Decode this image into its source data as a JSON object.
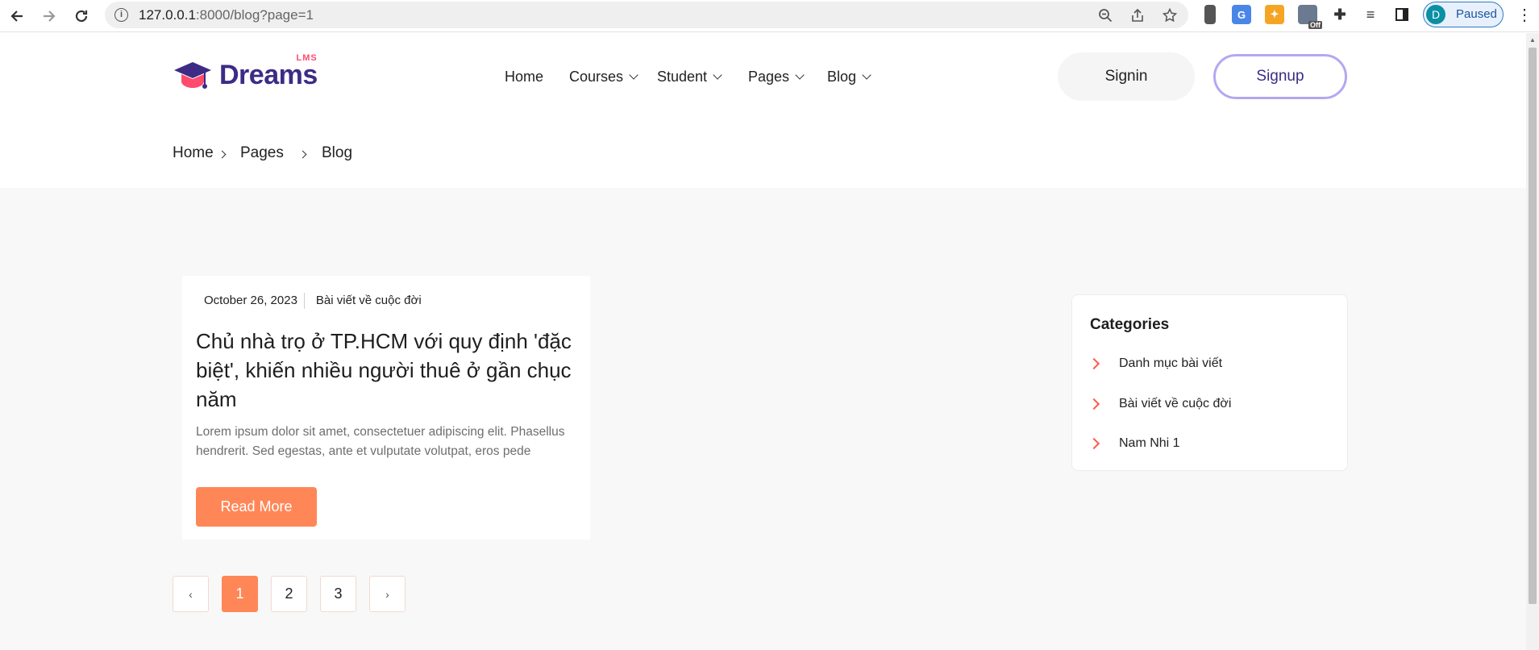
{
  "browser": {
    "url_host": "127.0.0.1",
    "url_rest": ":8000/blog?page=1",
    "profile_initial": "D",
    "profile_status": "Paused",
    "ext_badge": "Off"
  },
  "header": {
    "logo_text": "Dreams",
    "logo_sup": "LMS",
    "nav": [
      "Home",
      "Courses",
      "Student",
      "Pages",
      "Blog"
    ],
    "signin_label": "Signin",
    "signup_label": "Signup"
  },
  "breadcrumb": [
    "Home",
    "Pages",
    "Blog"
  ],
  "post": {
    "date": "October 26, 2023",
    "category": "Bài viết về cuộc đời",
    "title": "Chủ nhà trọ ở TP.HCM với quy định 'đặc biệt', khiến nhiều người thuê ở gần chục năm",
    "excerpt": "Lorem ipsum dolor sit amet, consectetuer adipiscing elit. Phasellus hendrerit. Sed egestas, ante et vulputate volutpat, eros pede",
    "read_more_label": "Read More"
  },
  "pagination": {
    "prev": "‹",
    "pages": [
      "1",
      "2",
      "3"
    ],
    "next": "›",
    "active": "1"
  },
  "sidebar": {
    "title": "Categories",
    "categories": [
      "Danh mục bài viết",
      "Bài viết về cuộc đời",
      "Nam Nhi 1"
    ]
  },
  "colors": {
    "accent": "#ff8757",
    "brand": "#3d2b86",
    "signup_border": "#b6a7f0"
  }
}
